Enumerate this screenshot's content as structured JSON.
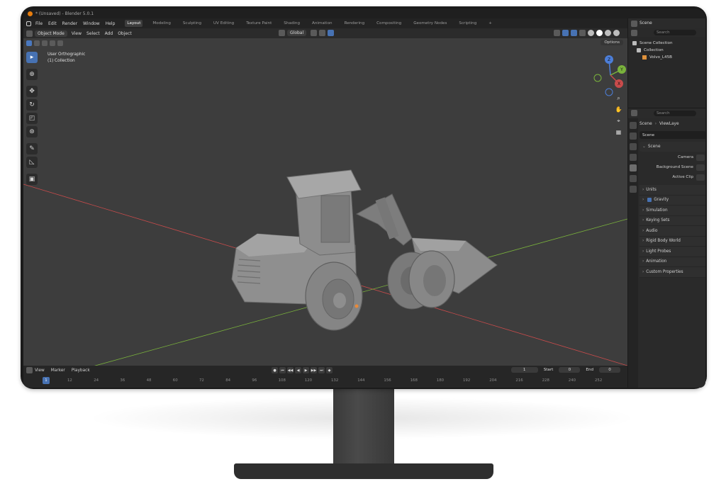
{
  "window": {
    "title": "* (Unsaved) - Blender 5.0.1"
  },
  "menu": [
    "File",
    "Edit",
    "Render",
    "Window",
    "Help"
  ],
  "workspaces": [
    "Layout",
    "Modeling",
    "Sculpting",
    "UV Editing",
    "Texture Paint",
    "Shading",
    "Animation",
    "Rendering",
    "Compositing",
    "Geometry Nodes",
    "Scripting",
    "+"
  ],
  "active_workspace": "Layout",
  "viewport_header": {
    "mode": "Object Mode",
    "menus": [
      "View",
      "Select",
      "Add",
      "Object"
    ],
    "orientation": "Global",
    "options": "Options"
  },
  "viewport": {
    "view_name": "User Orthographic",
    "collection_line": "(1) Collection",
    "axis_x": "X",
    "axis_y": "Y",
    "axis_z": "Z",
    "colors": {
      "x_axis": "#c94b4b",
      "y_axis": "#7ab33c",
      "z_axis": "#4c7ed9",
      "model": "#8a8a8a"
    }
  },
  "timeline": {
    "menus": [
      "View",
      "Marker",
      "Playback"
    ],
    "current_frame": "1",
    "start_label": "Start",
    "start_value": "0",
    "end_label": "End",
    "end_value": "0",
    "ticks": [
      "12",
      "24",
      "36",
      "48",
      "60",
      "72",
      "84",
      "96",
      "108",
      "120",
      "132",
      "144",
      "156",
      "168",
      "180",
      "192",
      "204",
      "216",
      "228",
      "240",
      "252"
    ]
  },
  "outliner": {
    "scene_label": "Scene",
    "search_placeholder": "Search",
    "rows": [
      "Scene Collection",
      "Collection",
      "Volvo_L45B"
    ]
  },
  "properties": {
    "search_placeholder": "Search",
    "breadcrumb_scene": "Scene",
    "breadcrumb_view_layer": "ViewLaye",
    "scene_field": "Scene",
    "panel_scene": "Scene",
    "camera_label": "Camera",
    "background_scene_label": "Background Scene",
    "active_clip_label": "Active Clip",
    "subpanels": [
      "Units",
      "Gravity",
      "Simulation",
      "Keying Sets",
      "Audio",
      "Rigid Body World",
      "Light Probes",
      "Animation",
      "Custom Properties"
    ]
  }
}
